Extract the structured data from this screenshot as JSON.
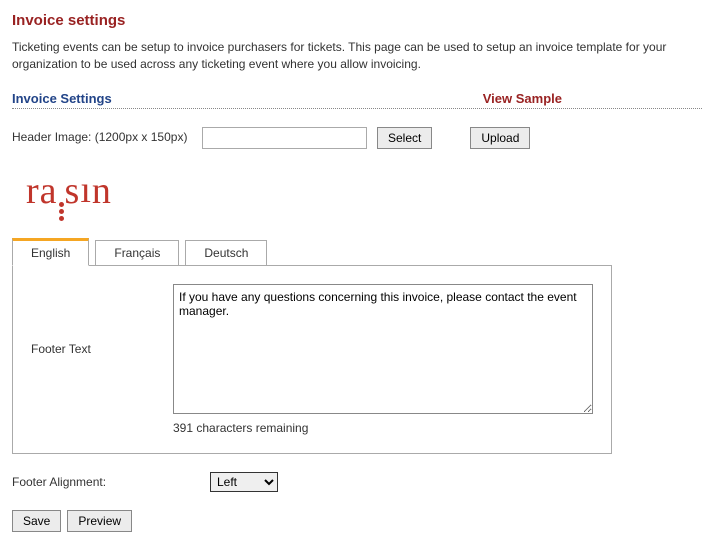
{
  "page_title": "Invoice settings",
  "intro_text": "Ticketing events can be setup to invoice purchasers for tickets. This page can be used to setup an invoice template for your organization to be used across any ticketing event where you allow invoicing.",
  "section_label": "Invoice Settings",
  "view_sample_label": "View Sample",
  "header_image": {
    "label": "Header Image: (1200px x 150px)",
    "value": "",
    "select_btn": "Select",
    "upload_btn": "Upload"
  },
  "logo_text": "raisin",
  "tabs": {
    "english": "English",
    "francais": "Français",
    "deutsch": "Deutsch"
  },
  "footer": {
    "label": "Footer Text",
    "value": "If you have any questions concerning this invoice, please contact the event manager.",
    "remaining": "391 characters remaining"
  },
  "alignment": {
    "label": "Footer Alignment:",
    "selected": "Left"
  },
  "buttons": {
    "save": "Save",
    "preview": "Preview"
  }
}
